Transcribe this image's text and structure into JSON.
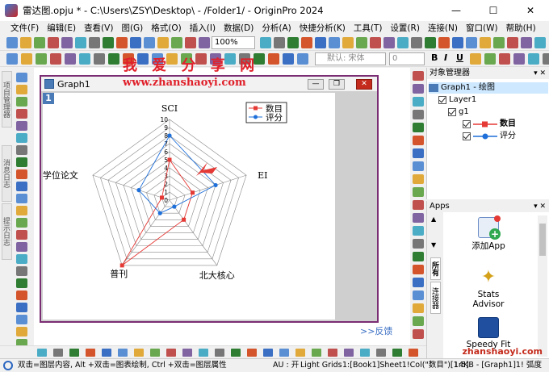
{
  "window": {
    "title": "雷达图.opju * - C:\\Users\\ZSY\\Desktop\\ - /Folder1/ - OriginPro 2024",
    "minimize": "—",
    "maximize": "☐",
    "close": "✕"
  },
  "menu": [
    "文件(F)",
    "编辑(E)",
    "查看(V)",
    "图(G)",
    "格式(O)",
    "插入(I)",
    "数据(D)",
    "分析(A)",
    "快捷分析(K)",
    "工具(T)",
    "设置(R)",
    "连接(N)",
    "窗口(W)",
    "帮助(H)"
  ],
  "toolbar": {
    "zoom": "100%",
    "font": "默认: 宋体",
    "font_size": "0",
    "bold": "B",
    "italic": "I",
    "underline": "U"
  },
  "left_tabs": [
    "项目管理器",
    "消息日志",
    "提示日志"
  ],
  "graph_window": {
    "title": "Graph1",
    "layer_badge": "1",
    "feedback": ">>反馈"
  },
  "watermark": {
    "cn": "我 爱 分 享 网",
    "url": "www.zhanshaoyi.com",
    "url_bottom": "zhanshaoyi.com"
  },
  "object_manager": {
    "title": "对象管理器",
    "pin": "▾ ✕",
    "graph": "Graph1 - 绘图",
    "layer": "Layer1",
    "group": "g1",
    "series": [
      "数目",
      "评分"
    ]
  },
  "apps": {
    "title": "Apps",
    "side_tabs": [
      "所有",
      "连接器"
    ],
    "items": [
      {
        "label": "添加App"
      },
      {
        "label": "Stats Advisor"
      },
      {
        "label": "Speedy Fit"
      }
    ]
  },
  "status": {
    "hint": "双击=图层内容, Alt +双击=图表绘制, Ctrl +双击=图层属性",
    "au": "AU : 开",
    "grids": "Light Grids",
    "col": "1:[Book1]Sheet1!Col(\"数目\")[1:5]",
    "size": "14KB - [Graph1]1!",
    "unit": "弧度"
  },
  "colors": {
    "series1": "#e53935",
    "series2": "#1e6fd9",
    "window_border": "#7b2d73",
    "selection": "#cde8ff"
  },
  "chart_data": {
    "type": "radar",
    "axes": [
      "SCI",
      "EI",
      "北大核心",
      "普刊",
      "学位论文"
    ],
    "rmin": 0,
    "rmax": 10,
    "ticks": [
      "0",
      "1",
      "2",
      "3",
      "4",
      "5",
      "6",
      "7",
      "8",
      "9",
      "10"
    ],
    "legend_placement": "top-right",
    "series": [
      {
        "name": "数目",
        "values": [
          5,
          3,
          3,
          10,
          1
        ]
      },
      {
        "name": "评分",
        "values": [
          8,
          6,
          1,
          2,
          4
        ]
      }
    ]
  }
}
